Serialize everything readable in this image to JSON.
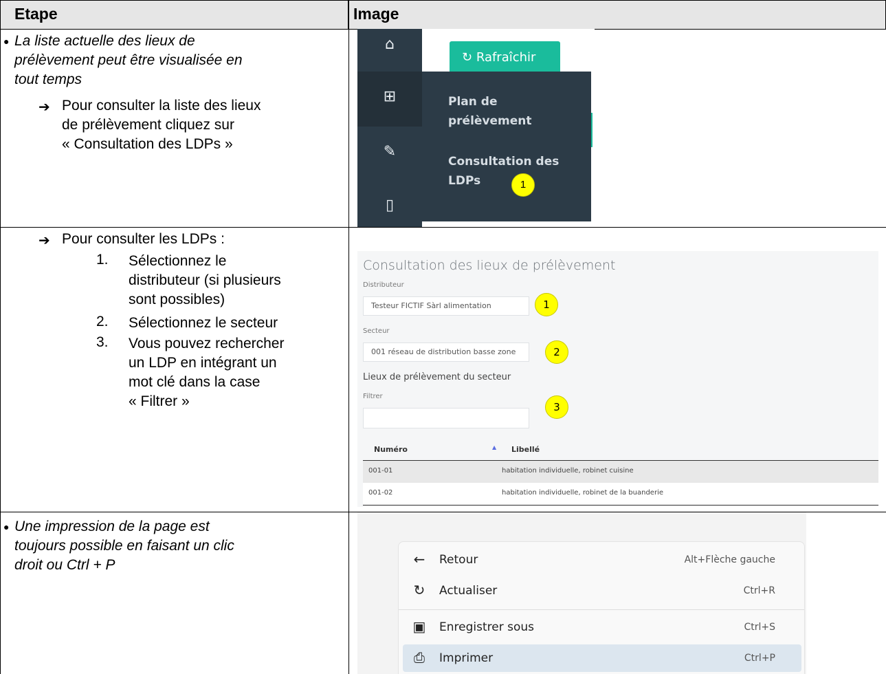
{
  "table": {
    "col_step": "Etape",
    "col_image": "Image"
  },
  "row1": {
    "text_lines": [
      "La liste actuelle des lieux de",
      "prélèvement peut être visualisée en",
      "tout temps"
    ],
    "arrow_lines": [
      "Pour consulter la liste des lieux",
      "de prélèvement cliquez sur",
      "« Consultation des LDPs »"
    ],
    "shot": {
      "refresh_label": "Rafraîchir",
      "menu_item1": [
        "Plan de",
        "prélèvement"
      ],
      "menu_item2": [
        "Consultation des",
        "LDPs"
      ],
      "badge": "1"
    }
  },
  "row2": {
    "arrow_line": "Pour consulter les LDPs :",
    "list": [
      {
        "n": "1.",
        "lines": [
          "Sélectionnez le",
          "distributeur (si plusieurs",
          "sont possibles)"
        ]
      },
      {
        "n": "2.",
        "lines": [
          "Sélectionnez le secteur"
        ]
      },
      {
        "n": "3.",
        "lines": [
          "Vous pouvez rechercher",
          "un LDP en intégrant un",
          "mot clé dans la case",
          "« Filtrer »"
        ]
      }
    ],
    "shot": {
      "title": "Consultation des lieux de prélèvement",
      "distributeur_label": "Distributeur",
      "distributeur_value": "Testeur FICTIF Sàrl alimentation",
      "secteur_label": "Secteur",
      "secteur_value": "001 réseau de distribution basse zone",
      "section_title": "Lieux de prélèvement du secteur",
      "filter_label": "Filtrer",
      "filter_value": "",
      "col_numero": "Numéro",
      "col_libelle": "Libellé",
      "rows": [
        {
          "numero": "001-01",
          "libelle": "habitation individuelle, robinet cuisine"
        },
        {
          "numero": "001-02",
          "libelle": "habitation individuelle, robinet de la buanderie"
        }
      ],
      "badges": [
        "1",
        "2",
        "3"
      ]
    }
  },
  "row3": {
    "text_lines": [
      "Une impression de la page est",
      "toujours possible en faisant un clic",
      "droit ou Ctrl + P"
    ],
    "shot": {
      "items": [
        {
          "icon": "arrow-left-icon",
          "label": "Retour",
          "shortcut": "Alt+Flèche gauche"
        },
        {
          "icon": "refresh-icon",
          "label": "Actualiser",
          "shortcut": "Ctrl+R"
        },
        {
          "icon": "save-as-icon",
          "label": "Enregistrer sous",
          "shortcut": "Ctrl+S"
        },
        {
          "icon": "printer-icon",
          "label": "Imprimer",
          "shortcut": "Ctrl+P"
        }
      ]
    }
  }
}
